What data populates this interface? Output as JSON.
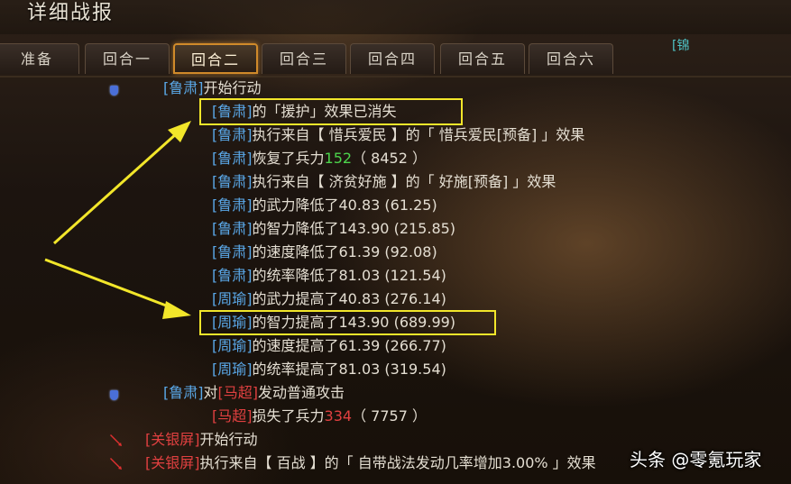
{
  "window": {
    "title": "详细战报"
  },
  "tabs": [
    {
      "label": "准备",
      "active": false
    },
    {
      "label": "回合一",
      "active": false
    },
    {
      "label": "回合二",
      "active": true
    },
    {
      "label": "回合三",
      "active": false
    },
    {
      "label": "回合四",
      "active": false
    },
    {
      "label": "回合五",
      "active": false
    },
    {
      "label": "回合六",
      "active": false
    }
  ],
  "tab_extra": "[锦",
  "log": {
    "l0": {
      "actor": "[鲁肃]",
      "text": "开始行动"
    },
    "l1": {
      "actor": "[鲁肃]",
      "text": "的「援护」效果已消失"
    },
    "l2": {
      "actor": "[鲁肃]",
      "text": "执行来自【 惜兵爱民 】的「 惜兵爱民[预备] 」效果"
    },
    "l3": {
      "actor": "[鲁肃]",
      "pre": "恢复了兵力",
      "num": "152",
      "post": "（ 8452 ）"
    },
    "l4": {
      "actor": "[鲁肃]",
      "text": "执行来自【 济贫好施 】的「 好施[预备] 」效果"
    },
    "l5": {
      "actor": "[鲁肃]",
      "text": "的武力降低了40.83 (61.25)"
    },
    "l6": {
      "actor": "[鲁肃]",
      "text": "的智力降低了143.90 (215.85)"
    },
    "l7": {
      "actor": "[鲁肃]",
      "text": "的速度降低了61.39 (92.08)"
    },
    "l8": {
      "actor": "[鲁肃]",
      "text": "的统率降低了81.03 (121.54)"
    },
    "l9": {
      "actor": "[周瑜]",
      "text": "的武力提高了40.83 (276.14)"
    },
    "l10": {
      "actor": "[周瑜]",
      "text": "的智力提高了143.90 (689.99)"
    },
    "l11": {
      "actor": "[周瑜]",
      "text": "的速度提高了61.39 (266.77)"
    },
    "l12": {
      "actor": "[周瑜]",
      "text": "的统率提高了81.03 (319.54)"
    },
    "l13": {
      "actor": "[鲁肃]",
      "mid": "对",
      "target": "[马超]",
      "text": "发动普通攻击"
    },
    "l14": {
      "actor": "[马超]",
      "pre": "损失了兵力",
      "num": "334",
      "post": "（ 7757 ）"
    },
    "l15": {
      "actor": "[关银屏]",
      "text": "开始行动"
    },
    "l16": {
      "actor": "[关银屏]",
      "text": "执行来自【 百战 】的「 自带战法发动几率增加3.00% 」效果"
    }
  },
  "watermark": "头条 @零氪玩家",
  "colors": {
    "ally_name": "#5aa8e8",
    "enemy_name": "#e04040",
    "heal_number": "#4cd44c",
    "damage_number": "#e04040",
    "highlight_box": "#f2e62a",
    "active_tab_border": "#d08a2a"
  },
  "icons": {
    "ally_turn": "shield-icon",
    "enemy_turn": "sword-icon",
    "annotation": "arrow-icon"
  }
}
